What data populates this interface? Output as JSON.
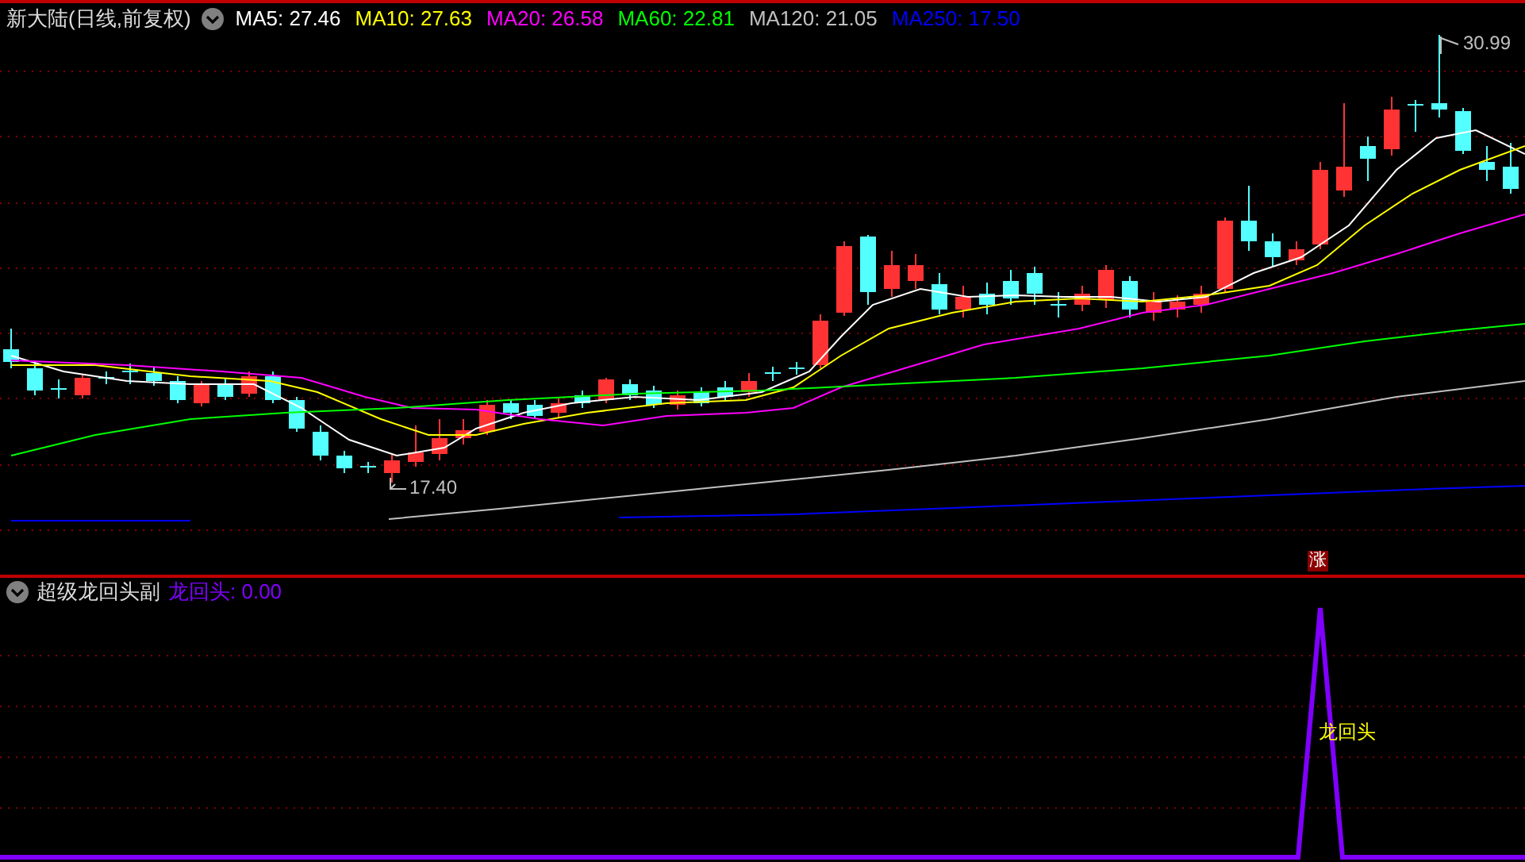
{
  "main_panel": {
    "title": "新大陆(日线,前复权)",
    "moving_averages": [
      {
        "text": "MA5: 27.46",
        "color": "#ffffff"
      },
      {
        "text": "MA10: 27.63",
        "color": "#ffff00"
      },
      {
        "text": "MA20: 26.58",
        "color": "#ff00ff"
      },
      {
        "text": "MA60: 22.81",
        "color": "#00ff00"
      },
      {
        "text": "MA120: 21.05",
        "color": "#c0c0c0"
      },
      {
        "text": "MA250: 17.50",
        "color": "#0000ff"
      }
    ],
    "high_label": "30.99",
    "low_label": "17.40",
    "signal_badge": "涨"
  },
  "indicator_panel": {
    "title": "超级龙回头副",
    "value_label": "龙回头: 0.00",
    "annotation": "龙回头"
  }
}
